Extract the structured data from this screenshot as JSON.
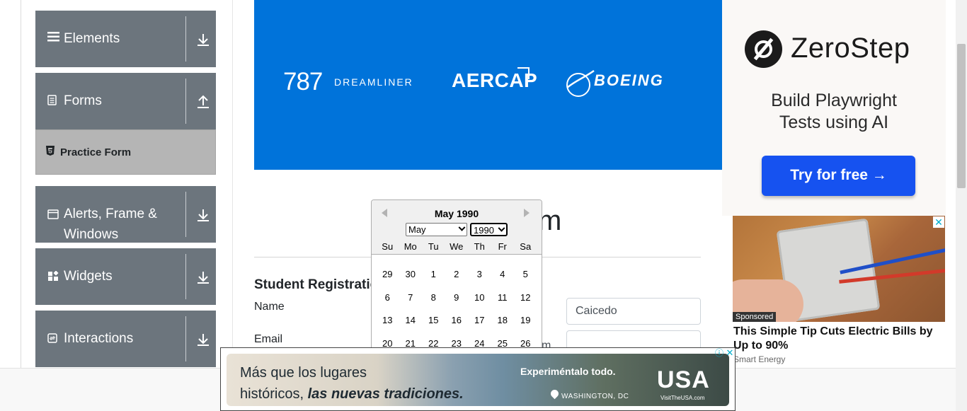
{
  "sidebar": {
    "groups": [
      {
        "label": "Elements",
        "icon": "hamburger-icon",
        "arrow": "download-icon"
      },
      {
        "label": "Forms",
        "icon": "document-icon",
        "arrow": "upload-icon"
      },
      {
        "label": "Alerts, Frame &",
        "label2": "Windows",
        "icon": "window-icon",
        "arrow": "download-icon"
      },
      {
        "label": "Widgets",
        "icon": "widgets-icon",
        "arrow": "download-icon"
      },
      {
        "label": "Interactions",
        "icon": "interactions-icon",
        "arrow": "download-icon"
      }
    ],
    "active_item": {
      "label": "Practice Form",
      "icon": "html-icon"
    }
  },
  "banner": {
    "logo1": "787",
    "logo1_sub": "DREAMLINER",
    "logo2": "AERCAP",
    "logo3": "BOEING",
    "color": "#0073da"
  },
  "form": {
    "title_tail": "m",
    "subtitle": "Student Registratio",
    "name_label": "Name",
    "email_label": "Email",
    "last_name_value": "Caicedo",
    "email_partial": "m"
  },
  "datepicker": {
    "header": "May 1990",
    "month_select": "May",
    "year_select": "1990",
    "weekdays": [
      "Su",
      "Mo",
      "Tu",
      "We",
      "Th",
      "Fr",
      "Sa"
    ],
    "weeks": [
      [
        "29",
        "30",
        "1",
        "2",
        "3",
        "4",
        "5"
      ],
      [
        "6",
        "7",
        "8",
        "9",
        "10",
        "11",
        "12"
      ],
      [
        "13",
        "14",
        "15",
        "16",
        "17",
        "18",
        "19"
      ],
      [
        "20",
        "21",
        "22",
        "23",
        "24",
        "25",
        "26"
      ]
    ]
  },
  "ad_right": {
    "brand": "ZeroStep",
    "line1": "Build Playwright",
    "line2": "Tests using AI",
    "cta": "Try for free →",
    "cta_color": "#1652f0",
    "sponsored": "Sponsored",
    "headline": "This Simple Tip Cuts Electric Bills by Up to 90%",
    "source": "Smart Energy"
  },
  "ad_bottom": {
    "line1": "Más que los lugares",
    "line2_plain": "históricos, ",
    "line2_bold": "las nuevas tradiciones.",
    "tagline": "Experiméntalo todo.",
    "location": "WASHINGTON, DC",
    "brand": "USA",
    "brand_sub": "VisitTheUSA.com"
  }
}
